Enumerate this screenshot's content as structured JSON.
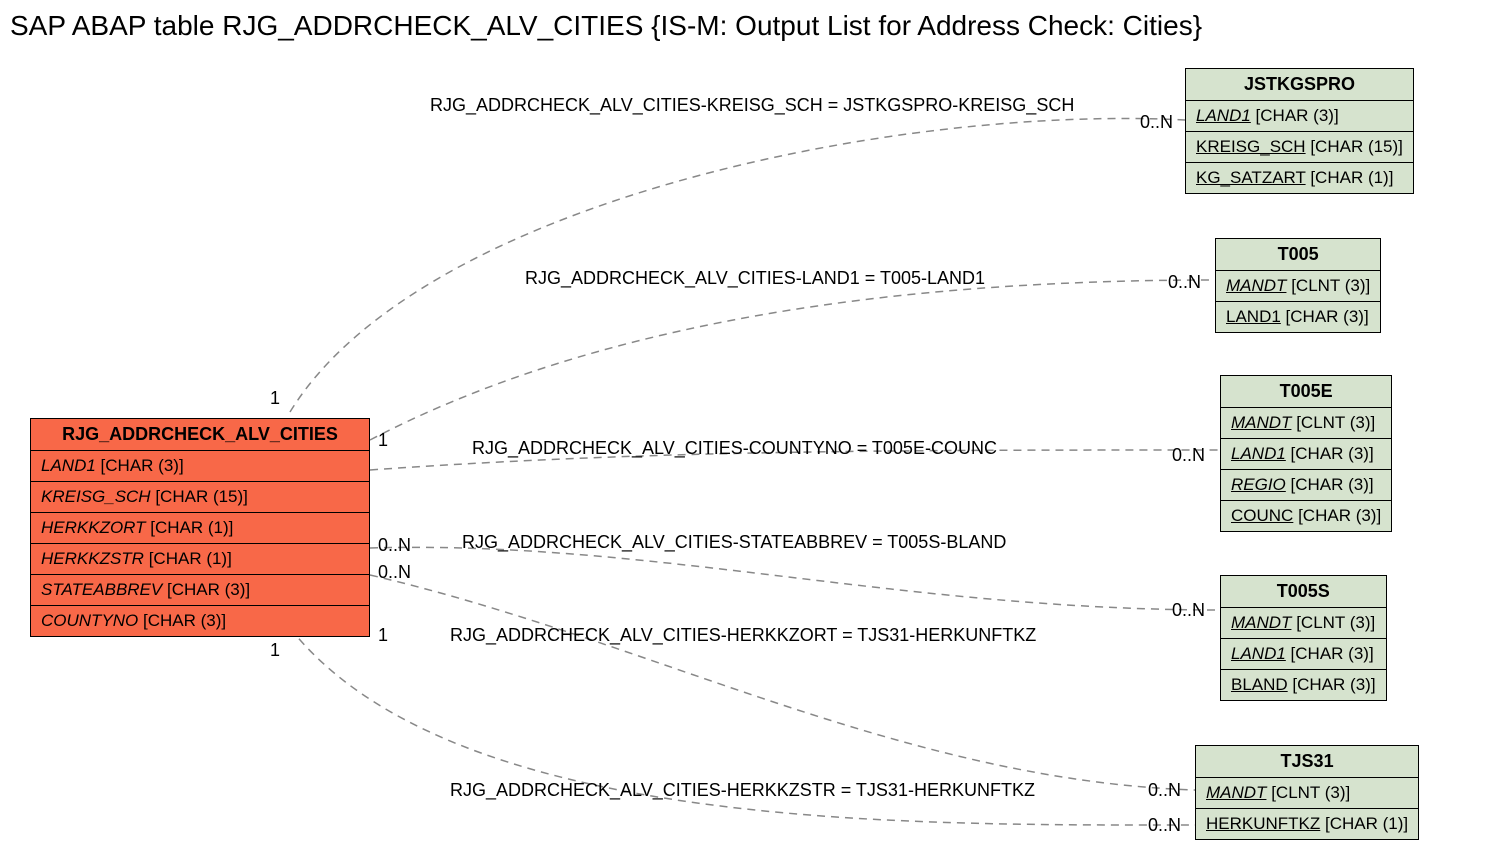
{
  "title": "SAP ABAP table RJG_ADDRCHECK_ALV_CITIES {IS-M: Output List for Address Check: Cities}",
  "main": {
    "name": "RJG_ADDRCHECK_ALV_CITIES",
    "fields": [
      {
        "name": "LAND1",
        "type": "[CHAR (3)]"
      },
      {
        "name": "KREISG_SCH",
        "type": "[CHAR (15)]"
      },
      {
        "name": "HERKKZORT",
        "type": "[CHAR (1)]"
      },
      {
        "name": "HERKKZSTR",
        "type": "[CHAR (1)]"
      },
      {
        "name": "STATEABBREV",
        "type": "[CHAR (3)]"
      },
      {
        "name": "COUNTYNO",
        "type": "[CHAR (3)]"
      }
    ]
  },
  "refs": {
    "jstkgspro": {
      "name": "JSTKGSPRO",
      "fields": [
        {
          "name": "LAND1",
          "type": "[CHAR (3)]",
          "italic": true
        },
        {
          "name": "KREISG_SCH",
          "type": "[CHAR (15)]"
        },
        {
          "name": "KG_SATZART",
          "type": "[CHAR (1)]"
        }
      ]
    },
    "t005": {
      "name": "T005",
      "fields": [
        {
          "name": "MANDT",
          "type": "[CLNT (3)]",
          "italic": true
        },
        {
          "name": "LAND1",
          "type": "[CHAR (3)]"
        }
      ]
    },
    "t005e": {
      "name": "T005E",
      "fields": [
        {
          "name": "MANDT",
          "type": "[CLNT (3)]",
          "italic": true
        },
        {
          "name": "LAND1",
          "type": "[CHAR (3)]",
          "italic": true
        },
        {
          "name": "REGIO",
          "type": "[CHAR (3)]",
          "italic": true
        },
        {
          "name": "COUNC",
          "type": "[CHAR (3)]"
        }
      ]
    },
    "t005s": {
      "name": "T005S",
      "fields": [
        {
          "name": "MANDT",
          "type": "[CLNT (3)]",
          "italic": true
        },
        {
          "name": "LAND1",
          "type": "[CHAR (3)]",
          "italic": true
        },
        {
          "name": "BLAND",
          "type": "[CHAR (3)]"
        }
      ]
    },
    "tjs31": {
      "name": "TJS31",
      "fields": [
        {
          "name": "MANDT",
          "type": "[CLNT (3)]",
          "italic": true
        },
        {
          "name": "HERKUNFTKZ",
          "type": "[CHAR (1)]"
        }
      ]
    }
  },
  "relations": {
    "r1": {
      "label": "RJG_ADDRCHECK_ALV_CITIES-KREISG_SCH = JSTKGSPRO-KREISG_SCH",
      "left": "1",
      "right": "0..N"
    },
    "r2": {
      "label": "RJG_ADDRCHECK_ALV_CITIES-LAND1 = T005-LAND1",
      "left": "1",
      "right": "0..N"
    },
    "r3": {
      "label": "RJG_ADDRCHECK_ALV_CITIES-COUNTYNO = T005E-COUNC",
      "left": "1",
      "right": "0..N"
    },
    "r4": {
      "label": "RJG_ADDRCHECK_ALV_CITIES-STATEABBREV = T005S-BLAND",
      "left": "0..N",
      "right": "0..N"
    },
    "r5": {
      "label": "RJG_ADDRCHECK_ALV_CITIES-HERKKZORT = TJS31-HERKUNFTKZ",
      "left": "0..N",
      "right": "0..N"
    },
    "r6": {
      "label": "RJG_ADDRCHECK_ALV_CITIES-HERKKZSTR = TJS31-HERKUNFTKZ",
      "left": "1",
      "right": "0..N"
    }
  }
}
